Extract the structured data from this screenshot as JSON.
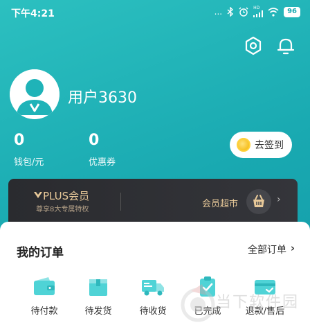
{
  "status_bar": {
    "time": "下午4:21",
    "dots": "...",
    "hd_label": "HD",
    "battery": "96"
  },
  "user": {
    "name": "用户3630"
  },
  "stats": [
    {
      "value": "0",
      "label": "钱包/元"
    },
    {
      "value": "0",
      "label": "优惠券"
    }
  ],
  "checkin": {
    "label": "去签到"
  },
  "plus": {
    "title": "PLUS会员",
    "subtitle": "尊享8大专属特权",
    "market": "会员超市",
    "arrow": "›"
  },
  "orders": {
    "title": "我的订单",
    "all_label": "全部订单",
    "chevron": "›",
    "items": [
      {
        "label": "待付款",
        "icon": "wallet-icon"
      },
      {
        "label": "待发货",
        "icon": "box-icon"
      },
      {
        "label": "待收货",
        "icon": "truck-icon"
      },
      {
        "label": "已完成",
        "icon": "clipboard-check-icon"
      },
      {
        "label": "退款/售后",
        "icon": "refund-card-icon"
      }
    ]
  },
  "watermark": {
    "text": "当下软件园"
  },
  "colors": {
    "brand": "#19a9b1",
    "accent_icon": "#4fd3d6",
    "plus_gold": "#e8c999"
  }
}
